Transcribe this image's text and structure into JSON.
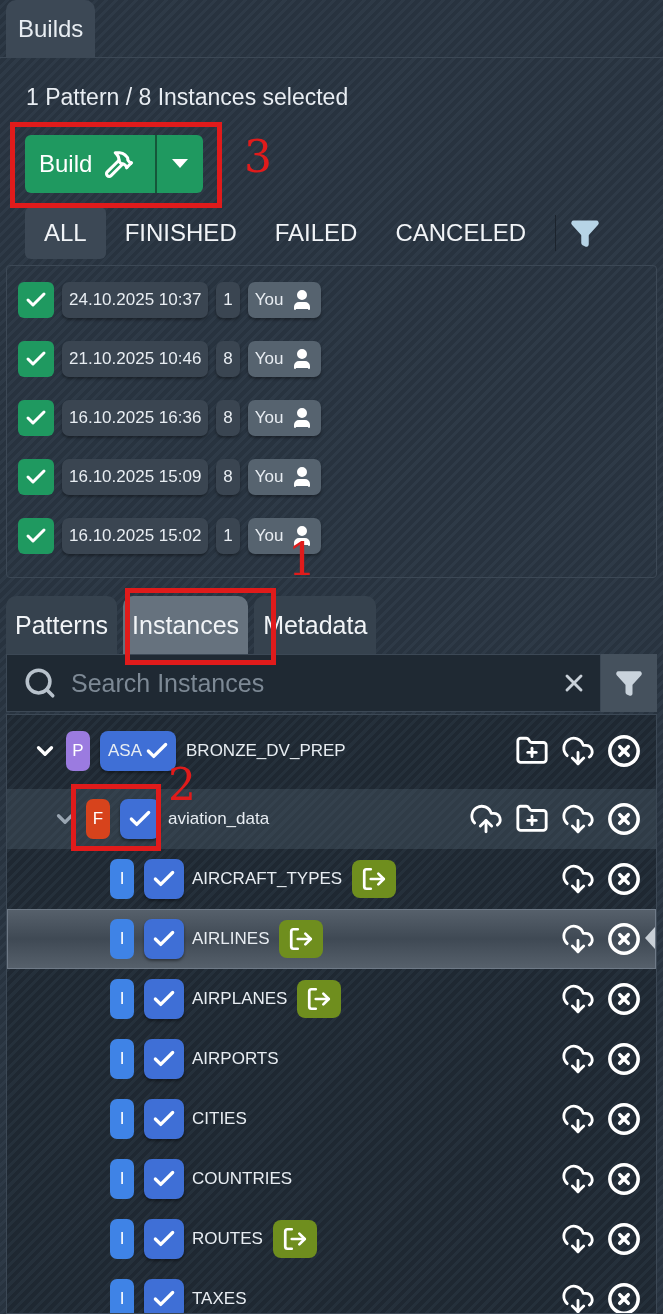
{
  "panel_tab": {
    "label": "Builds",
    "selected": true
  },
  "selection_summary": "1 Pattern / 8 Instances selected",
  "build_button": {
    "label": "Build"
  },
  "filter_tabs": [
    {
      "label": "ALL",
      "selected": true
    },
    {
      "label": "FINISHED",
      "selected": false
    },
    {
      "label": "FAILED",
      "selected": false
    },
    {
      "label": "CANCELED",
      "selected": false
    }
  ],
  "builds": [
    {
      "kind": "finished",
      "date": "24.10.2025 10:37",
      "count": "1",
      "user": "You"
    },
    {
      "kind": "finished",
      "date": "21.10.2025 10:46",
      "count": "8",
      "user": "You"
    },
    {
      "kind": "finished",
      "date": "16.10.2025 16:36",
      "count": "8",
      "user": "You"
    },
    {
      "kind": "finished",
      "date": "16.10.2025 15:09",
      "count": "8",
      "user": "You"
    },
    {
      "kind": "finished",
      "date": "16.10.2025 15:02",
      "count": "1",
      "user": "You"
    }
  ],
  "tabs": [
    {
      "label": "Patterns",
      "selected": false
    },
    {
      "label": "Instances",
      "selected": true
    },
    {
      "label": "Metadata",
      "selected": false
    }
  ],
  "search": {
    "placeholder": "Search Instances"
  },
  "tree": [
    {
      "kind": "pattern",
      "badge": "P",
      "tag": "ASA",
      "checked": true,
      "name": "BRONZE_DV_PREP",
      "expanded": true,
      "actions": [
        {
          "kind": "add_folder"
        },
        {
          "kind": "download"
        },
        {
          "kind": "remove"
        }
      ],
      "children": [
        {
          "kind": "folder",
          "badge": "F",
          "checked": true,
          "name": "aviation_data",
          "expanded": true,
          "actions": [
            {
              "kind": "upload"
            },
            {
              "kind": "add_folder"
            },
            {
              "kind": "download"
            },
            {
              "kind": "remove"
            }
          ],
          "children": [
            {
              "kind": "instance",
              "badge": "I",
              "checked": true,
              "name": "AIRCRAFT_TYPES",
              "exported": true,
              "selected": false,
              "actions": [
                {
                  "kind": "download"
                },
                {
                  "kind": "remove"
                }
              ]
            },
            {
              "kind": "instance",
              "badge": "I",
              "checked": true,
              "name": "AIRLINES",
              "exported": true,
              "selected": true,
              "actions": [
                {
                  "kind": "download"
                },
                {
                  "kind": "remove"
                }
              ]
            },
            {
              "kind": "instance",
              "badge": "I",
              "checked": true,
              "name": "AIRPLANES",
              "exported": true,
              "selected": false,
              "actions": [
                {
                  "kind": "download"
                },
                {
                  "kind": "remove"
                }
              ]
            },
            {
              "kind": "instance",
              "badge": "I",
              "checked": true,
              "name": "AIRPORTS",
              "exported": false,
              "selected": false,
              "actions": [
                {
                  "kind": "download"
                },
                {
                  "kind": "remove"
                }
              ]
            },
            {
              "kind": "instance",
              "badge": "I",
              "checked": true,
              "name": "CITIES",
              "exported": false,
              "selected": false,
              "actions": [
                {
                  "kind": "download"
                },
                {
                  "kind": "remove"
                }
              ]
            },
            {
              "kind": "instance",
              "badge": "I",
              "checked": true,
              "name": "COUNTRIES",
              "exported": false,
              "selected": false,
              "actions": [
                {
                  "kind": "download"
                },
                {
                  "kind": "remove"
                }
              ]
            },
            {
              "kind": "instance",
              "badge": "I",
              "checked": true,
              "name": "ROUTES",
              "exported": true,
              "selected": false,
              "actions": [
                {
                  "kind": "download"
                },
                {
                  "kind": "remove"
                }
              ]
            },
            {
              "kind": "instance",
              "badge": "I",
              "checked": true,
              "name": "TAXES",
              "exported": false,
              "selected": false,
              "actions": [
                {
                  "kind": "download"
                },
                {
                  "kind": "remove"
                }
              ]
            }
          ]
        }
      ]
    }
  ],
  "annotations": [
    {
      "label": "3",
      "kind": "build_button"
    },
    {
      "label": "1",
      "kind": "instances_tab"
    },
    {
      "label": "2",
      "kind": "folder_checkbox"
    }
  ]
}
